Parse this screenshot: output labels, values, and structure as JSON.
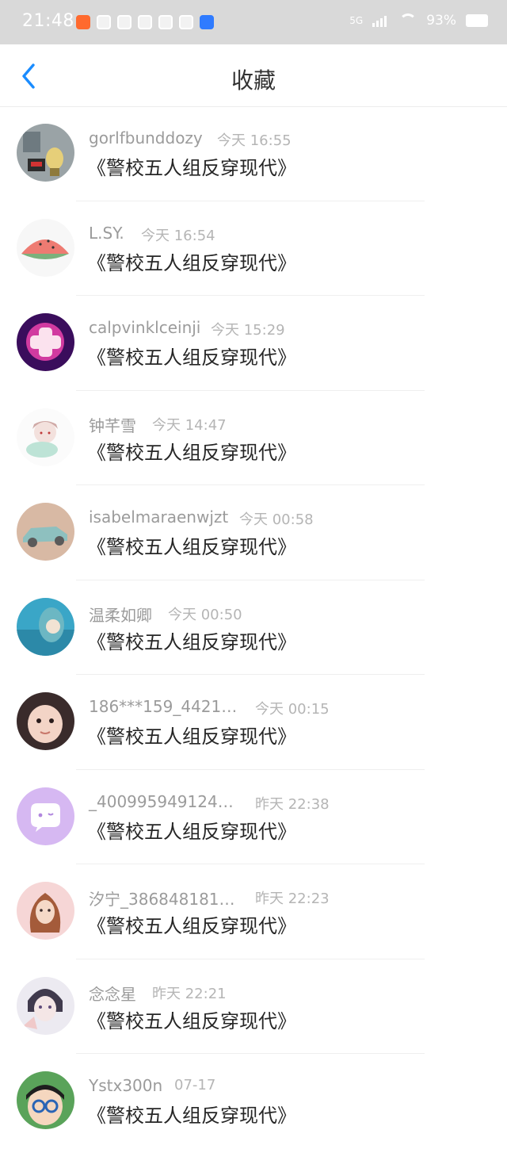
{
  "status_bar": {
    "time": "21:48",
    "network": "5G",
    "battery": "93%"
  },
  "header": {
    "title": "收藏"
  },
  "items": [
    {
      "user": "gorlfbunddozy",
      "time": "今天 16:55",
      "title": "《警校五人组反穿现代》"
    },
    {
      "user": "L.SY.",
      "time": "今天 16:54",
      "title": "《警校五人组反穿现代》"
    },
    {
      "user": "calpvinklceinji",
      "time": "今天 15:29",
      "title": "《警校五人组反穿现代》"
    },
    {
      "user": "钟芊雪",
      "time": "今天 14:47",
      "title": "《警校五人组反穿现代》"
    },
    {
      "user": "isabelmaraenwjzt",
      "time": "今天 00:58",
      "title": "《警校五人组反穿现代》"
    },
    {
      "user": "温柔如卿",
      "time": "今天 00:50",
      "title": "《警校五人组反穿现代》"
    },
    {
      "user": "186***159_4421…",
      "time": "今天 00:15",
      "title": "《警校五人组反穿现代》"
    },
    {
      "user": "_400995949124…",
      "time": "昨天 22:38",
      "title": "《警校五人组反穿现代》"
    },
    {
      "user": "汐宁_386848181…",
      "time": "昨天 22:23",
      "title": "《警校五人组反穿现代》"
    },
    {
      "user": "念念星",
      "time": "昨天 22:21",
      "title": "《警校五人组反穿现代》"
    },
    {
      "user": "Ystx300n",
      "time": "07-17",
      "title": "《警校五人组反穿现代》"
    }
  ],
  "colors": {
    "accent": "#1a8cff",
    "text_primary": "#262626",
    "text_secondary": "#9b9b9b"
  }
}
